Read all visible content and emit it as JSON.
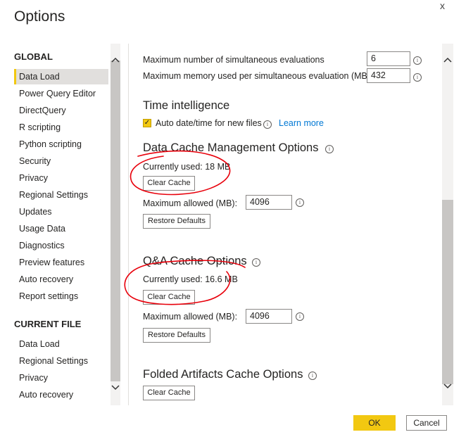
{
  "dialog": {
    "title": "Options",
    "close_glyph": "x"
  },
  "sidebar": {
    "global_heading": "GLOBAL",
    "global_items": [
      {
        "label": "Data Load",
        "selected": true
      },
      {
        "label": "Power Query Editor"
      },
      {
        "label": "DirectQuery"
      },
      {
        "label": "R scripting"
      },
      {
        "label": "Python scripting"
      },
      {
        "label": "Security"
      },
      {
        "label": "Privacy"
      },
      {
        "label": "Regional Settings"
      },
      {
        "label": "Updates"
      },
      {
        "label": "Usage Data"
      },
      {
        "label": "Diagnostics"
      },
      {
        "label": "Preview features"
      },
      {
        "label": "Auto recovery"
      },
      {
        "label": "Report settings"
      }
    ],
    "current_file_heading": "CURRENT FILE",
    "current_file_items": [
      {
        "label": "Data Load"
      },
      {
        "label": "Regional Settings"
      },
      {
        "label": "Privacy"
      },
      {
        "label": "Auto recovery"
      }
    ]
  },
  "main": {
    "max_evals_label": "Maximum number of simultaneous evaluations",
    "max_evals_value": "6",
    "max_memory_label": "Maximum memory used per simultaneous evaluation (MB)",
    "max_memory_value": "432",
    "time_intel_heading": "Time intelligence",
    "auto_datetime_label": "Auto date/time for new files",
    "auto_datetime_checked": true,
    "learn_more": "Learn more",
    "data_cache": {
      "heading": "Data Cache Management Options",
      "currently_used": "Currently used: 18 MB",
      "clear_button": "Clear Cache",
      "max_allowed_label": "Maximum allowed (MB):",
      "max_allowed_value": "4096",
      "restore_button": "Restore Defaults"
    },
    "qa_cache": {
      "heading": "Q&A Cache Options",
      "currently_used": "Currently used: 16.6 MB",
      "clear_button": "Clear Cache",
      "max_allowed_label": "Maximum allowed (MB):",
      "max_allowed_value": "4096",
      "restore_button": "Restore Defaults"
    },
    "folded_cache": {
      "heading": "Folded Artifacts Cache Options",
      "clear_button": "Clear Cache"
    }
  },
  "footer": {
    "ok": "OK",
    "cancel": "Cancel"
  },
  "colors": {
    "accent": "#f2c811",
    "link": "#0078d4",
    "annotation": "#e8000b"
  }
}
